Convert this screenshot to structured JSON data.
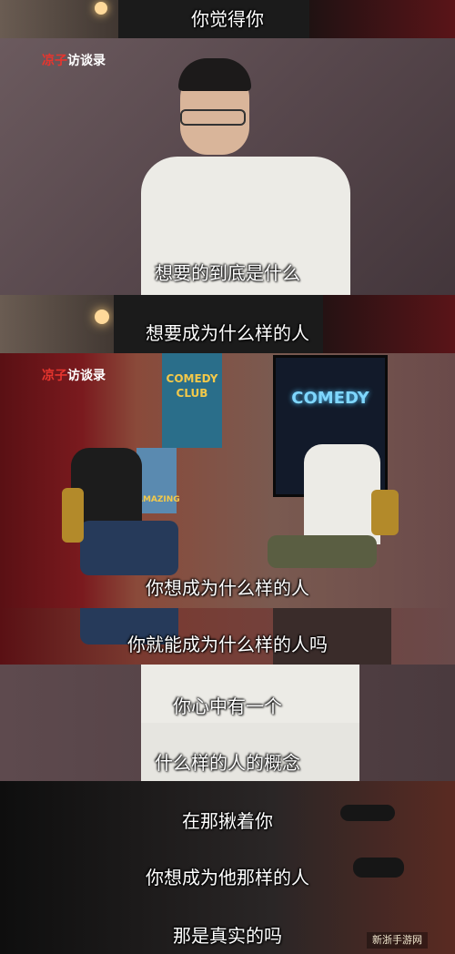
{
  "frames": [
    {
      "subtitle": "你觉得你"
    },
    {
      "subtitle": "想要的到底是什么",
      "logo": {
        "part1": "凉子",
        "part2": "访谈录"
      }
    },
    {
      "subtitle": "想要成为什么样的人"
    },
    {
      "subtitle": "你想成为什么样的人",
      "logo": {
        "part1": "凉子",
        "part2": "访谈录"
      },
      "sign_text": "COMEDY",
      "poster_text": "COMEDY CLUB",
      "poster2_text": "AMAZING"
    },
    {
      "subtitle": "你就能成为什么样的人吗"
    },
    {
      "subtitle": "你心中有一个"
    },
    {
      "subtitle": "什么样的人的概念"
    },
    {
      "subtitle": "在那揪着你"
    },
    {
      "subtitle": "你想成为他那样的人"
    },
    {
      "subtitle": "那是真实的吗"
    }
  ],
  "watermark": "新浙手游网"
}
